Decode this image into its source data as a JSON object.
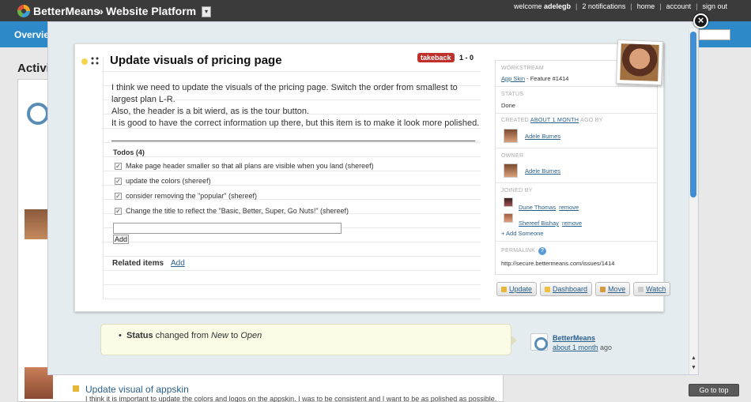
{
  "topbar": {
    "brand": "BetterMeans",
    "separator": "»",
    "project": "Website Platform",
    "dropdown_glyph": "▾",
    "welcome_prefix": "welcome",
    "username": "adelegb",
    "notifications": "2 notifications",
    "home": "home",
    "account": "account",
    "signout": "sign out"
  },
  "bluebar": {
    "tab": "Overview"
  },
  "background": {
    "heading": "Activity",
    "story_title": "Update visual of appskin",
    "story_desc": "I think it is important to update the colors and logos on the appskin. I was to be consistent and I want to be as polished as possible.",
    "go_to_top": "Go to top"
  },
  "modal": {
    "close_glyph": "×",
    "title": "Update visuals of pricing page",
    "takeback": "takeback",
    "score": "1 - 0",
    "description": [
      "I think we need to update the visuals of the pricing page. Switch the order from smallest to largest plan L-R.",
      "Also, the header is a bit wierd, as is the tour button.",
      "It is good to have the correct information up there, but this item is to make it look more polished."
    ],
    "todos_heading": "Todos (4)",
    "todos": [
      "Make page header smaller so that all plans are visible when you land (shereef)",
      "update the colors (shereef)",
      "consider removing the \"popular\" (shereef)",
      "Change the title to reflect the \"Basic, Better, Super, Go Nuts!\" (shereef)"
    ],
    "check_glyph": "✓",
    "add_button": "Add",
    "related_label": "Related items",
    "related_add": "Add",
    "sidebar": {
      "workstream_label": "WORKSTREAM",
      "workstream_link": "App Skin",
      "workstream_suffix": " - Feature #1414",
      "status_label": "STATUS",
      "status_value": "Done",
      "created_prefix": "CREATED",
      "created_link": "ABOUT 1 MONTH",
      "created_suffix": "AGO BY",
      "created_by": "Adele Burnes",
      "owner_label": "OWNER",
      "owner": "Adele Burnes",
      "joined_label": "JOINED BY",
      "joined": [
        {
          "name": "Dune Thomas",
          "action": "remove"
        },
        {
          "name": "Shereef Bishay",
          "action": "remove"
        }
      ],
      "add_someone": "+ Add Someone",
      "permalink_label": "PERMALINK",
      "help_glyph": "?",
      "permalink": "http://secure.bettermeans.com/issues/1414"
    },
    "buttons": [
      "Update",
      "Dashboard",
      "Move",
      "Watch"
    ],
    "activity": {
      "status_word": "Status",
      "changed": " changed from ",
      "from": "New",
      "to_word": " to ",
      "to": "Open",
      "who": "BetterMeans",
      "when_link": "about 1 month",
      "when_suffix": " ago"
    }
  },
  "colors": {
    "accent": "#2e89c9",
    "takeback": "#c0302a",
    "scroll_thumb": "#3f8ed6"
  },
  "icons": [
    "logo-icon",
    "close-icon",
    "bulb-icon",
    "drag-handle-icon",
    "checkbox-icon",
    "help-icon",
    "pencil-icon",
    "dashboard-icon",
    "move-icon",
    "watch-icon"
  ]
}
